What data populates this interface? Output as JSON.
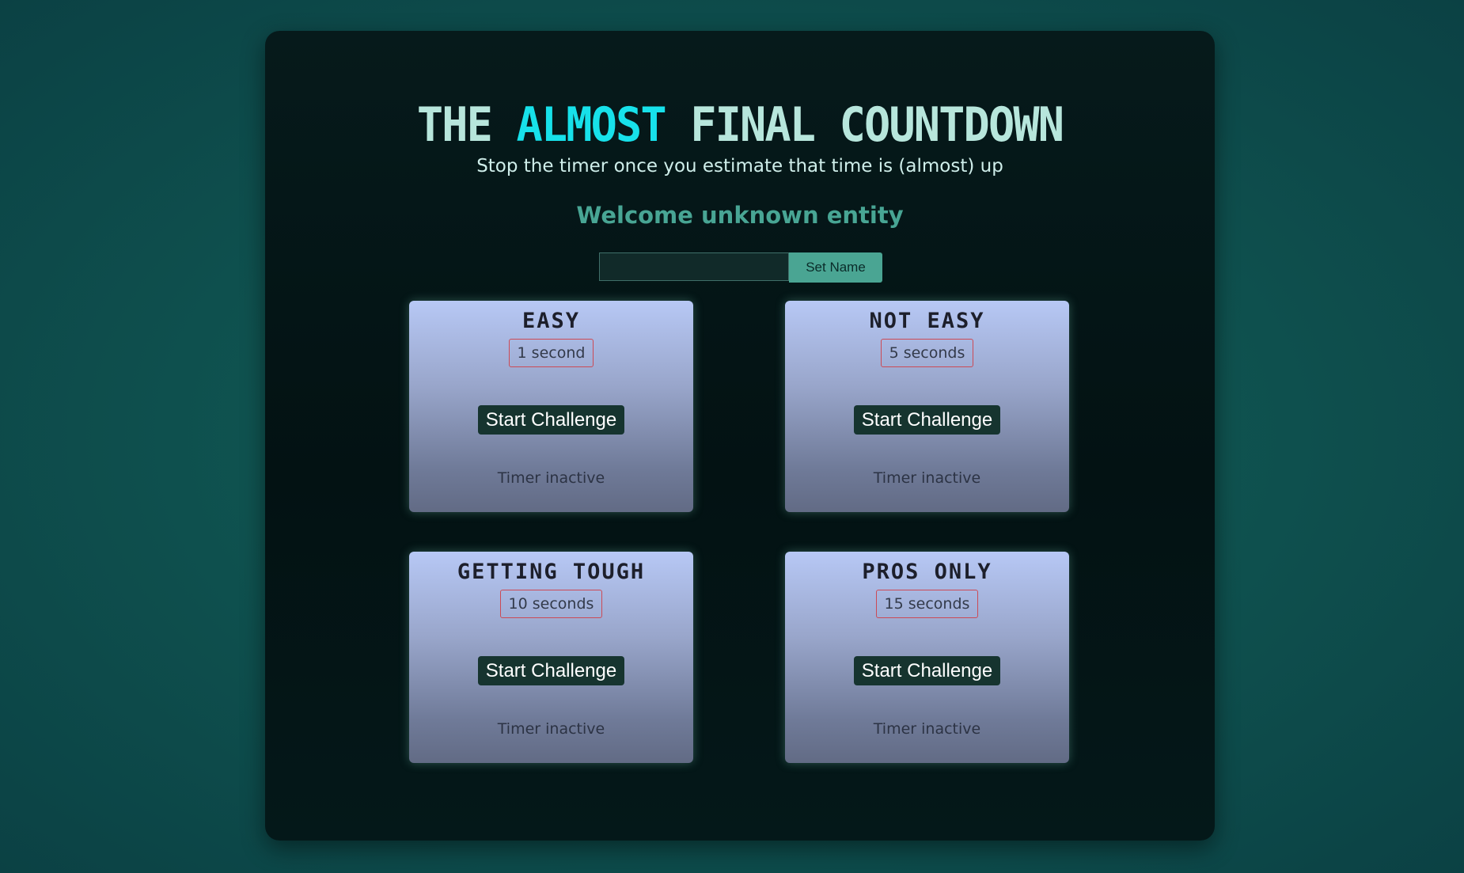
{
  "header": {
    "title_part1": "THE ",
    "title_accent": "ALMOST",
    "title_part2": " FINAL COUNTDOWN",
    "subtitle": "Stop the timer once you estimate that time is (almost) up",
    "welcome": "Welcome unknown entity"
  },
  "name_form": {
    "input_value": "",
    "set_name_label": "Set Name"
  },
  "challenges": [
    {
      "title": "EASY",
      "duration": "1 second",
      "button_label": "Start Challenge",
      "status": "Timer inactive"
    },
    {
      "title": "NOT EASY",
      "duration": "5 seconds",
      "button_label": "Start Challenge",
      "status": "Timer inactive"
    },
    {
      "title": "GETTING TOUGH",
      "duration": "10 seconds",
      "button_label": "Start Challenge",
      "status": "Timer inactive"
    },
    {
      "title": "PROS ONLY",
      "duration": "15 seconds",
      "button_label": "Start Challenge",
      "status": "Timer inactive"
    }
  ],
  "colors": {
    "accent": "#17e1ea",
    "title": "#b7e6dc",
    "welcome": "#48a594",
    "button_bg": "#16342f",
    "duration_border": "#cc4a55"
  }
}
